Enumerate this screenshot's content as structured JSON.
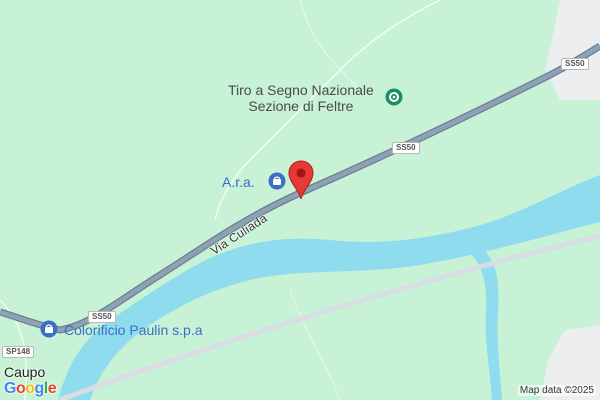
{
  "map": {
    "places": {
      "tiro_a_segno": {
        "line1": "Tiro a Segno Nazionale",
        "line2": "Sezione di Feltre"
      },
      "ara": {
        "label": "A.r.a."
      },
      "colorificio": {
        "label": "Colorificio Paulin s.p.a"
      },
      "town": {
        "label": "Caupo"
      }
    },
    "roads": {
      "ss50_top": "SS50",
      "ss50_middle": "SS50",
      "ss50_left": "SS50",
      "sp148": "SP148",
      "via_culiada": "Via Culiada"
    },
    "logo": [
      "G",
      "o",
      "o",
      "g",
      "l",
      "e"
    ],
    "attribution": "Map data ©2025",
    "colors": {
      "land": "#c8f2d6",
      "water": "#8fdcee",
      "road": "#8a9db0",
      "poi_shopping": "#3a6fc4",
      "poi_recreation": "#1e8e64",
      "marker": "#e53935",
      "logo": [
        "#4285F4",
        "#EA4335",
        "#FBBC05",
        "#4285F4",
        "#34A853",
        "#EA4335"
      ]
    },
    "icons": [
      "shopping-bag-icon",
      "recreation-icon",
      "location-pin-icon"
    ]
  }
}
